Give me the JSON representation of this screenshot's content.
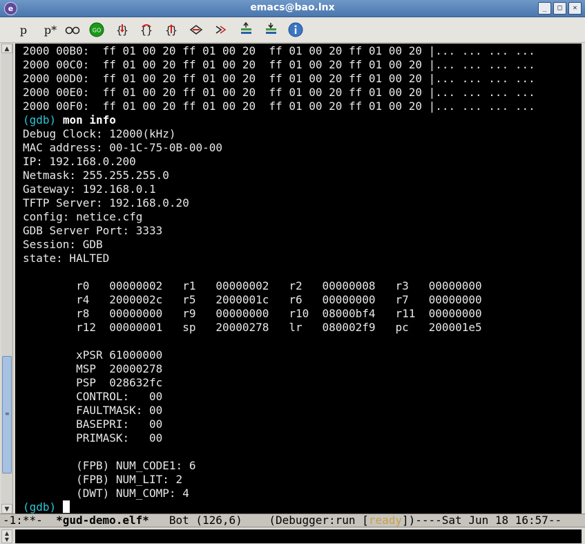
{
  "window": {
    "title": "emacs@bao.lnx",
    "minimize": "_",
    "maximize": "□",
    "close": "✕"
  },
  "toolbar": {
    "p_label": "p",
    "pstar_label": "p*",
    "go_label": "GO",
    "buttons": [
      "print-icon",
      "print-star-icon",
      "watch-glasses-icon",
      "go-icon",
      "step-into-icon",
      "step-over-icon",
      "step-out-icon",
      "until-icon",
      "finish-icon",
      "up-frame-icon",
      "down-frame-icon",
      "info-icon"
    ],
    "colors": {
      "go": "#1a9a1a",
      "info": "#3b76c4",
      "brace": "#cc2222"
    }
  },
  "console": {
    "hex_lines": [
      "2000 00B0:  ff 01 00 20 ff 01 00 20  ff 01 00 20 ff 01 00 20 |... ... ... ...",
      "2000 00C0:  ff 01 00 20 ff 01 00 20  ff 01 00 20 ff 01 00 20 |... ... ... ...",
      "2000 00D0:  ff 01 00 20 ff 01 00 20  ff 01 00 20 ff 01 00 20 |... ... ... ...",
      "2000 00E0:  ff 01 00 20 ff 01 00 20  ff 01 00 20 ff 01 00 20 |... ... ... ...",
      "2000 00F0:  ff 01 00 20 ff 01 00 20  ff 01 00 20 ff 01 00 20 |... ... ... ..."
    ],
    "prompt": "(gdb)",
    "command": "mon info",
    "info_lines": [
      "Debug Clock: 12000(kHz)",
      "MAC address: 00-1C-75-0B-00-00",
      "IP: 192.168.0.200",
      "Netmask: 255.255.255.0",
      "Gateway: 192.168.0.1",
      "TFTP Server: 192.168.0.20",
      "config: netice.cfg",
      "GDB Server Port: 3333",
      "Session: GDB",
      "state: HALTED"
    ],
    "register_lines": [
      "        r0   00000002   r1   00000002   r2   00000008   r3   00000000",
      "        r4   2000002c   r5   2000001c   r6   00000000   r7   00000000",
      "        r8   00000000   r9   00000000   r10  08000bf4   r11  00000000",
      "        r12  00000001   sp   20000278   lr   080002f9   pc   200001e5"
    ],
    "special_lines": [
      "        xPSR 61000000",
      "        MSP  20000278",
      "        PSP  028632fc",
      "        CONTROL:   00",
      "        FAULTMASK: 00",
      "        BASEPRI:   00",
      "        PRIMASK:   00"
    ],
    "fpb_lines": [
      "        (FPB) NUM_CODE1: 6",
      "        (FPB) NUM_LIT: 2",
      "        (DWT) NUM_COMP: 4"
    ],
    "final_prompt": "(gdb) "
  },
  "modeline": {
    "status": "-1:**-  ",
    "buffer": "*gud-demo.elf*",
    "position": "   Bot (126,6)    ",
    "mode_pre": "(Debugger:run [",
    "ready": "ready",
    "mode_post": "])----Sat Jun 18 16:57--"
  }
}
